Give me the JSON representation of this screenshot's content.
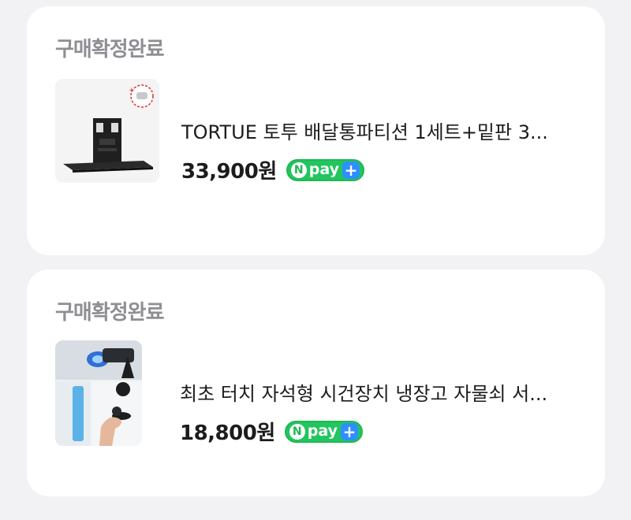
{
  "orders": [
    {
      "status": "구매확정완료",
      "title": "TORTUE 토투 배달통파티션 1세트+밑판 3...",
      "price": "33,900원",
      "pay_badge": {
        "n": "N",
        "text": "pay",
        "plus": "+"
      },
      "image_icon": "partition-product-icon"
    },
    {
      "status": "구매확정완료",
      "title": "최초 터치 자석형 시건장치 냉장고 자물쇠 서...",
      "price": "18,800원",
      "pay_badge": {
        "n": "N",
        "text": "pay",
        "plus": "+"
      },
      "image_icon": "magnetic-lock-product-icon"
    }
  ],
  "colors": {
    "status_text": "#8e8e93",
    "npay_green": "#22c55e",
    "npay_plus_blue": "#2f8fff"
  }
}
